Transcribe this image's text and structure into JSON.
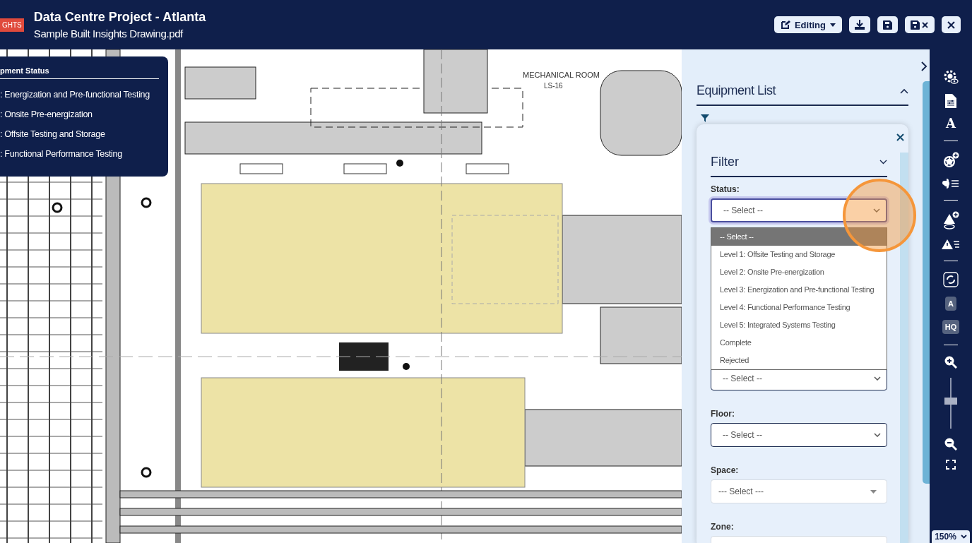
{
  "header": {
    "badge": "GHTS",
    "title": "Data Centre Project - Atlanta",
    "subtitle": "Sample Built Insights Drawing.pdf",
    "mode_button": "Editing"
  },
  "drawing": {
    "room_label": "MECHANICAL ROOM",
    "room_tag": "LS-16"
  },
  "legend": {
    "title": "pment Status",
    "items": [
      ": Energization and Pre-functional Testing",
      ": Onsite Pre-energization",
      ": Offsite Testing and Storage",
      ": Functional Performance Testing"
    ]
  },
  "panel": {
    "title": "Equipment List",
    "expanded": true,
    "filter": {
      "title": "Filter",
      "fields": [
        {
          "kind": "native",
          "label": "Status:",
          "value": "-- Select --",
          "open": true,
          "options": [
            {
              "label": "-- Select --",
              "selected": true
            },
            {
              "label": "Level 1: Offsite Testing and Storage",
              "selected": false
            },
            {
              "label": "Level 2: Onsite Pre-energization",
              "selected": false
            },
            {
              "label": "Level 3: Energization and Pre-functional Testing",
              "selected": false
            },
            {
              "label": "Level 4: Functional Performance Testing",
              "selected": false
            },
            {
              "label": "Level 5: Integrated Systems Testing",
              "selected": false
            },
            {
              "label": "Complete",
              "selected": false
            },
            {
              "label": "Rejected",
              "selected": false
            }
          ]
        },
        {
          "kind": "native",
          "value": "-- Select --",
          "open": false
        },
        {
          "kind": "native",
          "label": "Floor:",
          "value": "-- Select --",
          "open": false
        },
        {
          "kind": "styled",
          "label": "Space:",
          "value": "--- Select ---",
          "open": false
        },
        {
          "kind": "styled",
          "label": "Zone:",
          "open": false
        }
      ]
    }
  },
  "toolbar": {
    "text_tool": "A",
    "auto_label": "A",
    "hq": "HQ",
    "zoom": {
      "level": 0.55,
      "value": "150%"
    }
  }
}
